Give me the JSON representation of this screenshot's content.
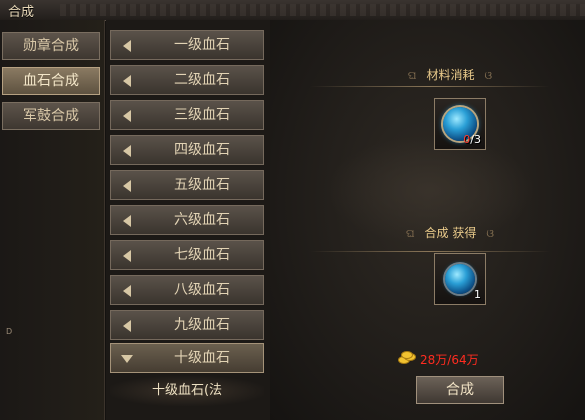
{
  "window": {
    "title": "合成"
  },
  "categories": [
    {
      "label": "勋章合成",
      "active": false
    },
    {
      "label": "血石合成",
      "active": true
    },
    {
      "label": "军鼓合成",
      "active": false
    }
  ],
  "edge_glyph": "D",
  "levels": [
    {
      "label": "一级血石"
    },
    {
      "label": "二级血石"
    },
    {
      "label": "三级血石"
    },
    {
      "label": "四级血石"
    },
    {
      "label": "五级血石"
    },
    {
      "label": "六级血石"
    },
    {
      "label": "七级血石"
    },
    {
      "label": "八级血石"
    },
    {
      "label": "九级血石"
    },
    {
      "label": "十级血石",
      "expanded": true
    }
  ],
  "sub_item": {
    "label": "十级血石(法"
  },
  "materials": {
    "heading": "材料消耗",
    "have": "0",
    "need": "/3"
  },
  "result": {
    "heading": "合成  获得",
    "count": "1"
  },
  "cost": {
    "text": "28万/64万"
  },
  "craft_button": {
    "label": "合成"
  },
  "colors": {
    "accent": "#e8c98a",
    "insufficient": "#ff2c20"
  }
}
